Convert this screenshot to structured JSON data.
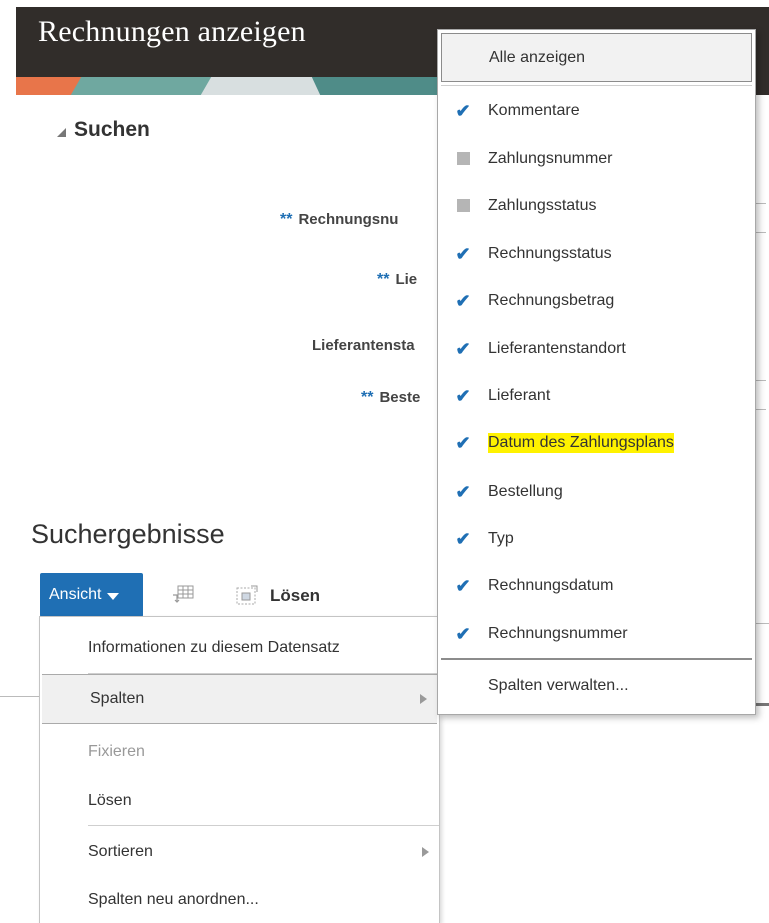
{
  "header": {
    "title": "Rechnungen anzeigen"
  },
  "search": {
    "title": "Suchen",
    "required_marker": "**",
    "fields": [
      {
        "label": "Rechnungsnu",
        "required": true
      },
      {
        "label": "Lie",
        "required": true
      },
      {
        "label": "Lieferantensta",
        "required": false
      },
      {
        "label": "Beste",
        "required": true
      }
    ]
  },
  "results": {
    "title": "Suchergebnisse",
    "toolbar": {
      "view_label": "Ansicht",
      "detach_label": "Lösen"
    }
  },
  "view_menu": {
    "items": [
      {
        "label": "Informationen zu diesem Datensatz",
        "disabled": false,
        "submenu": false
      },
      {
        "label": "Spalten",
        "disabled": false,
        "submenu": true,
        "selected": true
      },
      {
        "label": "Fixieren",
        "disabled": true,
        "submenu": false
      },
      {
        "label": "Lösen",
        "disabled": false,
        "submenu": false
      },
      {
        "label": "Sortieren",
        "disabled": false,
        "submenu": true
      },
      {
        "label": "Spalten neu anordnen...",
        "disabled": false,
        "submenu": false
      }
    ]
  },
  "columns_menu": {
    "show_all": "Alle anzeigen",
    "items": [
      {
        "label": "Kommentare",
        "state": "checked"
      },
      {
        "label": "Zahlungsnummer",
        "state": "partial"
      },
      {
        "label": "Zahlungsstatus",
        "state": "partial"
      },
      {
        "label": "Rechnungsstatus",
        "state": "checked"
      },
      {
        "label": "Rechnungsbetrag",
        "state": "checked"
      },
      {
        "label": "Lieferantenstandort",
        "state": "checked"
      },
      {
        "label": "Lieferant",
        "state": "checked"
      },
      {
        "label": "Datum des Zahlungsplans",
        "state": "checked",
        "highlighted": true
      },
      {
        "label": "Bestellung",
        "state": "checked"
      },
      {
        "label": "Typ",
        "state": "checked"
      },
      {
        "label": "Rechnungsdatum",
        "state": "checked"
      },
      {
        "label": "Rechnungsnummer",
        "state": "checked"
      }
    ],
    "manage": "Spalten verwalten..."
  },
  "colors": {
    "header_bg": "#312d2a",
    "accent": "#1f6fb4",
    "highlight": "#fff200"
  }
}
